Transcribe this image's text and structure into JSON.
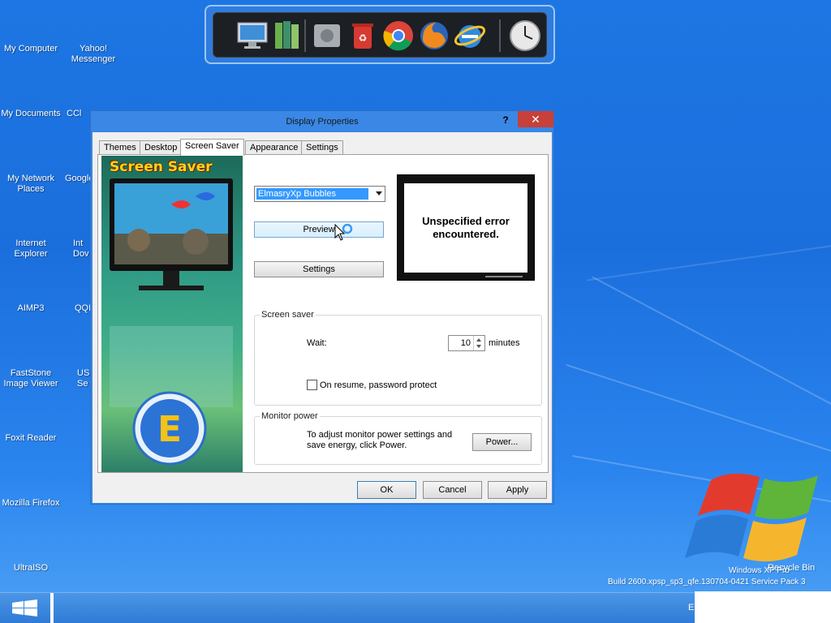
{
  "desktop_icons": [
    {
      "label": "My Computer"
    },
    {
      "label": "Yahoo!\nMessenger"
    },
    {
      "label": "My Documents"
    },
    {
      "label": "CCl"
    },
    {
      "label": "My Network\nPlaces"
    },
    {
      "label": "Google"
    },
    {
      "label": "Internet\nExplorer"
    },
    {
      "label": "Int\nDov"
    },
    {
      "label": "AIMP3"
    },
    {
      "label": "QQI"
    },
    {
      "label": "FastStone\nImage Viewer"
    },
    {
      "label": "USI\nSe"
    },
    {
      "label": "Foxit Reader"
    },
    {
      "label": "Mozilla Firefox"
    },
    {
      "label": "UltraISO"
    },
    {
      "label": "Recycle Bin"
    }
  ],
  "dock": {
    "items": [
      "monitor-icon",
      "books-icon",
      "disk-icon",
      "recycle-bin-icon",
      "chrome-icon",
      "firefox-icon",
      "internet-explorer-icon",
      "clock-icon"
    ]
  },
  "window": {
    "title": "Display Properties",
    "help": "?",
    "close": "✕",
    "tabs": [
      "Themes",
      "Desktop",
      "Screen Saver",
      "Appearance",
      "Settings"
    ],
    "active_tab": "Screen Saver",
    "side_banner_title": "Screen Saver",
    "screensaver_select": "ElmasryXp Bubbles",
    "preview_button": "Preview",
    "settings_button": "Settings",
    "monitor_message": "Unspecified error encountered.",
    "screen_saver_group": {
      "label": "Screen saver",
      "wait_label": "Wait:",
      "wait_value": "10",
      "minutes_label": "minutes",
      "password_label": "On resume, password protect",
      "password_checked": false
    },
    "monitor_power_group": {
      "label": "Monitor power",
      "description": "To adjust monitor power settings and save energy, click Power.",
      "power_button": "Power..."
    },
    "ok_button": "OK",
    "cancel_button": "Cancel",
    "apply_button": "Apply"
  },
  "watermark": {
    "line1": "Windows XP Pro",
    "line2": "Build 2600.xpsp_sp3_qfe.130704-0421 Service Pack 3"
  },
  "taskbar": {
    "tray_text": "E"
  },
  "colors": {
    "desktop": "#1d76e3",
    "window_frame": "#3a87e6",
    "close_button": "#c7403a",
    "selection": "#3399ff"
  }
}
